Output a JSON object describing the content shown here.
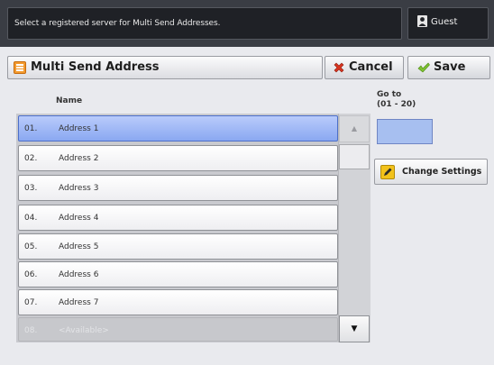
{
  "header": {
    "message": "Select a registered server for Multi Send Addresses.",
    "user_label": "Guest"
  },
  "titlebar": {
    "title": "Multi Send Address",
    "cancel_label": "Cancel",
    "save_label": "Save"
  },
  "list": {
    "column_header": "Name",
    "rows": [
      {
        "num": "01.",
        "label": "Address 1",
        "selected": true
      },
      {
        "num": "02.",
        "label": "Address 2"
      },
      {
        "num": "03.",
        "label": "Address 3"
      },
      {
        "num": "04.",
        "label": "Address 4"
      },
      {
        "num": "05.",
        "label": "Address 5"
      },
      {
        "num": "06.",
        "label": "Address 6"
      },
      {
        "num": "07.",
        "label": "Address 7"
      },
      {
        "num": "08.",
        "label": "<Available>",
        "available": true
      }
    ]
  },
  "goto": {
    "label": "Go to\n(01 - 20)",
    "value": ""
  },
  "change_settings_label": "Change Settings",
  "scroll": {
    "up_glyph": "▲",
    "down_glyph": "▼"
  },
  "colors": {
    "selected_row": "#9ab3f4",
    "goto_field": "#a7bff0",
    "cancel_icon": "#d8341f",
    "save_icon": "#7fc232"
  }
}
